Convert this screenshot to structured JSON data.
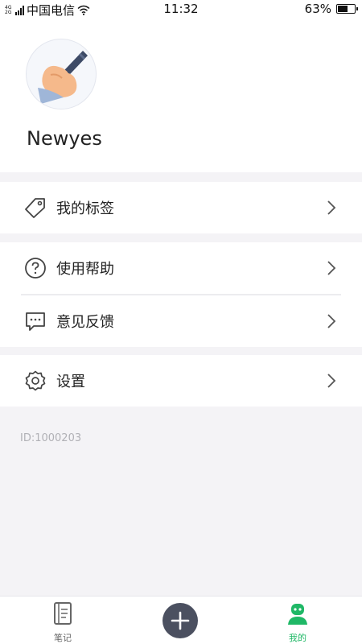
{
  "status_bar": {
    "network": "4G\n2G",
    "carrier": "中国电信",
    "time": "11:32",
    "battery_percent": "63%",
    "battery_level": 0.63
  },
  "profile": {
    "username": "Newyes"
  },
  "menu": {
    "tags_label": "我的标签",
    "help_label": "使用帮助",
    "feedback_label": "意见反馈",
    "settings_label": "设置"
  },
  "user_id": "ID:1000203",
  "tab_bar": {
    "notes_label": "笔记",
    "mine_label": "我的"
  },
  "colors": {
    "accent_green": "#1fb866",
    "add_button": "#4b5060",
    "background": "#f4f3f6"
  },
  "icons": {
    "tags": "tag-icon",
    "help": "question-circle-icon",
    "feedback": "chat-bubble-icon",
    "settings": "gear-icon",
    "chevron": "chevron-right-icon",
    "notes_tab": "notebook-icon",
    "add": "plus-icon",
    "mine_tab": "robot-avatar-icon"
  }
}
